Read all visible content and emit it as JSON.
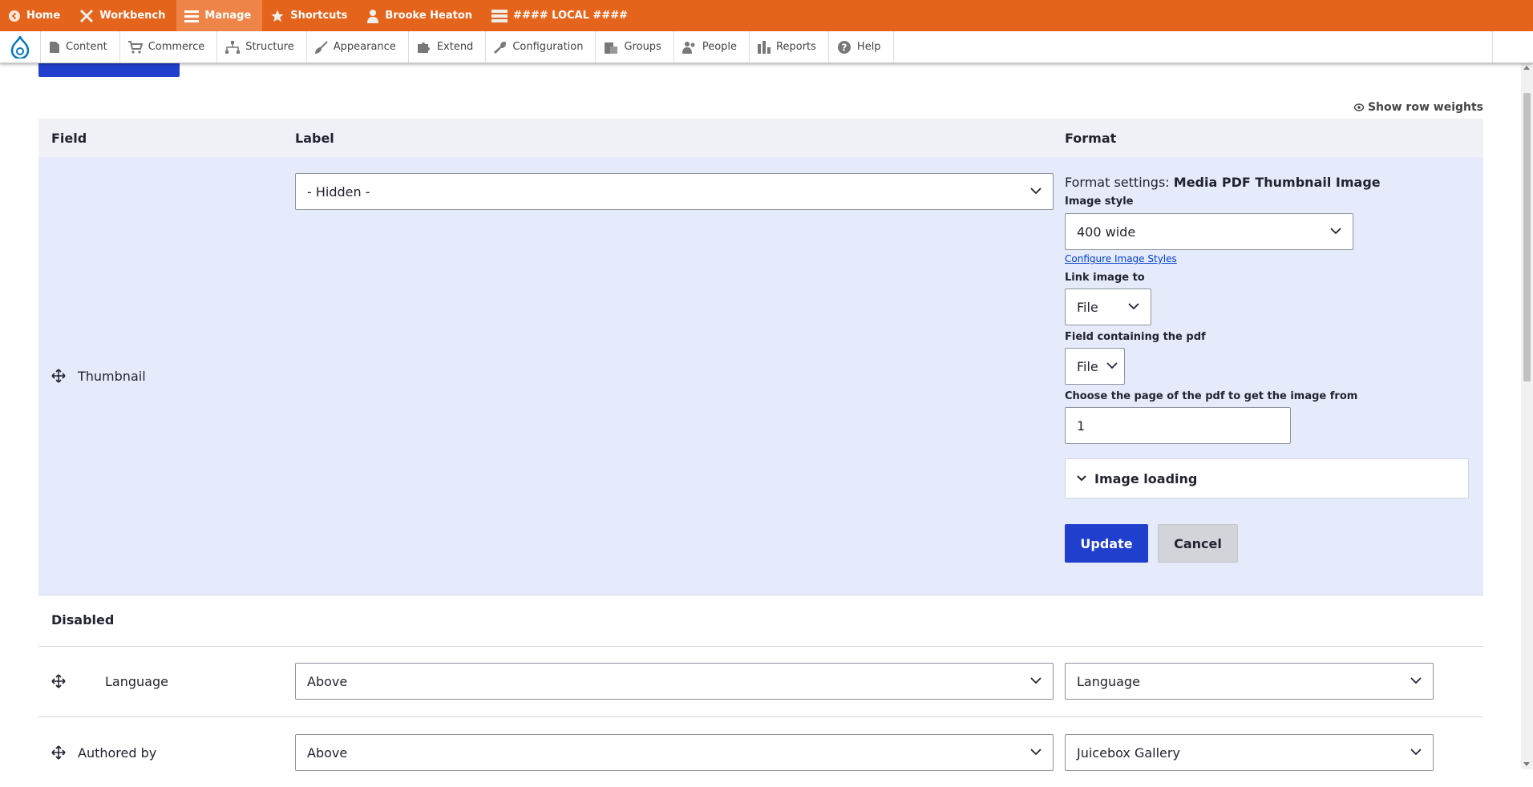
{
  "toolbar": {
    "home": "Home",
    "workbench": "Workbench",
    "manage": "Manage",
    "shortcuts": "Shortcuts",
    "user": "Brooke Heaton",
    "environment": "#### LOCAL ####",
    "color": "#e4641c"
  },
  "tray": {
    "items": [
      "Content",
      "Commerce",
      "Structure",
      "Appearance",
      "Extend",
      "Configuration",
      "Groups",
      "People",
      "Reports",
      "Help"
    ]
  },
  "actions": {
    "show_row_weights": "Show row weights"
  },
  "table": {
    "headers": {
      "field": "Field",
      "label": "Label",
      "format": "Format"
    }
  },
  "thumbnail_row": {
    "name": "Thumbnail",
    "label_value": "- Hidden -",
    "format_settings_prefix": "Format settings:",
    "format_settings_name": "Media PDF Thumbnail Image",
    "image_style_label": "Image style",
    "image_style_value": "400 wide",
    "configure_link": "Configure Image Styles",
    "link_image_label": "Link image to",
    "link_image_value": "File",
    "pdf_field_label": "Field containing the pdf",
    "pdf_field_value": "File",
    "page_label": "Choose the page of the pdf to get the image from",
    "page_value": "1",
    "image_loading": "Image loading",
    "update": "Update",
    "cancel": "Cancel"
  },
  "disabled_section": "Disabled",
  "rows": [
    {
      "name": "Language",
      "label": "Above",
      "format": "Language"
    },
    {
      "name": "Authored by",
      "label": "Above",
      "format": "Juicebox Gallery"
    }
  ]
}
